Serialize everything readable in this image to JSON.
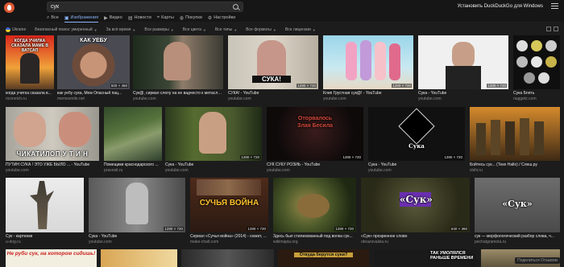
{
  "search": {
    "query": "сук"
  },
  "header": {
    "install_link": "Установить DuckDuckGo для Windows"
  },
  "tabs": [
    {
      "label": "Все",
      "icon": "search-icon"
    },
    {
      "label": "Изображения",
      "icon": "image-icon"
    },
    {
      "label": "Видео",
      "icon": "video-icon"
    },
    {
      "label": "Новости",
      "icon": "news-icon"
    },
    {
      "label": "Карты",
      "icon": "map-pin-icon"
    },
    {
      "label": "Покупки",
      "icon": "shopping-icon"
    },
    {
      "label": "Настройки",
      "icon": "settings-icon"
    }
  ],
  "filters": {
    "region": "Ukraine",
    "safe_search": "Безопасный поиск: умеренный",
    "time": "За всё время",
    "size": "Все размеры",
    "color": "Все цвета",
    "type": "Все типы",
    "layout": "Все форматы",
    "license": "Все лицензии"
  },
  "rows": [
    [
      {
        "title": "когда учитка сказала в...",
        "site": "riconeich.ru",
        "dim": "",
        "caption": "КОГДА УЧИЛКА СКАЗАЛА МАМЕ В ВАТСАП"
      },
      {
        "title": "как уебу сука, Мем Опасный пац...",
        "site": "memesmile.net",
        "dim": "500 × 460",
        "caption": "КАК УЕБУ"
      },
      {
        "title": "Сук@, сирвал слепу на ее вадчесто к метасло...",
        "site": "youtube.com",
        "dim": "",
        "caption": ""
      },
      {
        "title": "СУКА! - YouTube",
        "site": "youtube.com",
        "dim": "1280 × 720",
        "caption": "СУКА!"
      },
      {
        "title": "Клип Грустная сук@! - YouTube",
        "site": "youtube.com",
        "dim": "1280 × 720",
        "caption": ""
      },
      {
        "title": "Сука - YouTube",
        "site": "youtube.com",
        "dim": "1280 × 720",
        "caption": ""
      },
      {
        "title": "Сука Блять",
        "site": "nuggetz.com",
        "dim": "",
        "caption": ""
      }
    ],
    [
      {
        "title": "ПУТИН СУКА ! ЭТО УЖЕ БЫЛО ... - YouTube",
        "site": "youtube.com",
        "dim": "",
        "caption": "ЧИКАТИЛОП У Т И Н"
      },
      {
        "title": "Помещики краснодарского ...",
        "site": "pravosti.ru",
        "dim": "",
        "caption": ""
      },
      {
        "title": "Сука - YouTube",
        "site": "youtube.com",
        "dim": "1280 × 720",
        "caption": ""
      },
      {
        "title": "СУК СУКУ РОЗИЬ - YouTube",
        "site": "youtube.com",
        "dim": "1280 × 720",
        "caption": "Оторвалось Злая Бесила"
      },
      {
        "title": "Сука - YouTube",
        "site": "youtube.com",
        "dim": "1280 × 720",
        "caption": "Сука"
      },
      {
        "title": "Бойтесь сук... (Теке Hallo) / Слеш.ру",
        "site": "slshi.ru",
        "dim": "",
        "caption": ""
      }
    ],
    [
      {
        "title": "Сук - картинки",
        "site": "u-dog.ru",
        "dim": "",
        "caption": ""
      },
      {
        "title": "Сука - YouTube",
        "site": "youtube.com",
        "dim": "1280 × 720",
        "caption": ""
      },
      {
        "title": "Сериал «Сучья война» (2014) - сюжет, ...",
        "site": "make-chatl.com",
        "dim": "1280 × 720",
        "caption": "СУЧЬЯ ВОЙНА"
      },
      {
        "title": "Здесь был стилизованный под волка сук...",
        "site": "wikimapia.org",
        "dim": "1280 × 720",
        "caption": ""
      },
      {
        "title": "«Сук» прозренное слово",
        "site": "obrazovalsia.ru",
        "dim": "640 × 360",
        "caption": "«Сук»"
      },
      {
        "title": "сук — морфологический разбор слова, ч...",
        "site": "pechatgramota.ru",
        "dim": "",
        "caption": "«Сук»"
      }
    ],
    [
      {
        "title": "",
        "site": "",
        "dim": "",
        "caption": "Не руби сук, на котором сидишь!"
      },
      {
        "title": "",
        "site": "",
        "dim": "",
        "caption": ""
      },
      {
        "title": "",
        "site": "",
        "dim": "",
        "caption": ""
      },
      {
        "title": "",
        "site": "",
        "dim": "",
        "caption": "Откуда берутся суки?"
      },
      {
        "title": "",
        "site": "",
        "dim": "",
        "caption": "ТАК УМОЛЯЛСЯ РАНЬШЕ ВРЕМЕНИ"
      },
      {
        "title": "",
        "site": "",
        "dim": "",
        "caption": ""
      }
    ]
  ],
  "overlay_badge": "Поделиться Отзывом"
}
